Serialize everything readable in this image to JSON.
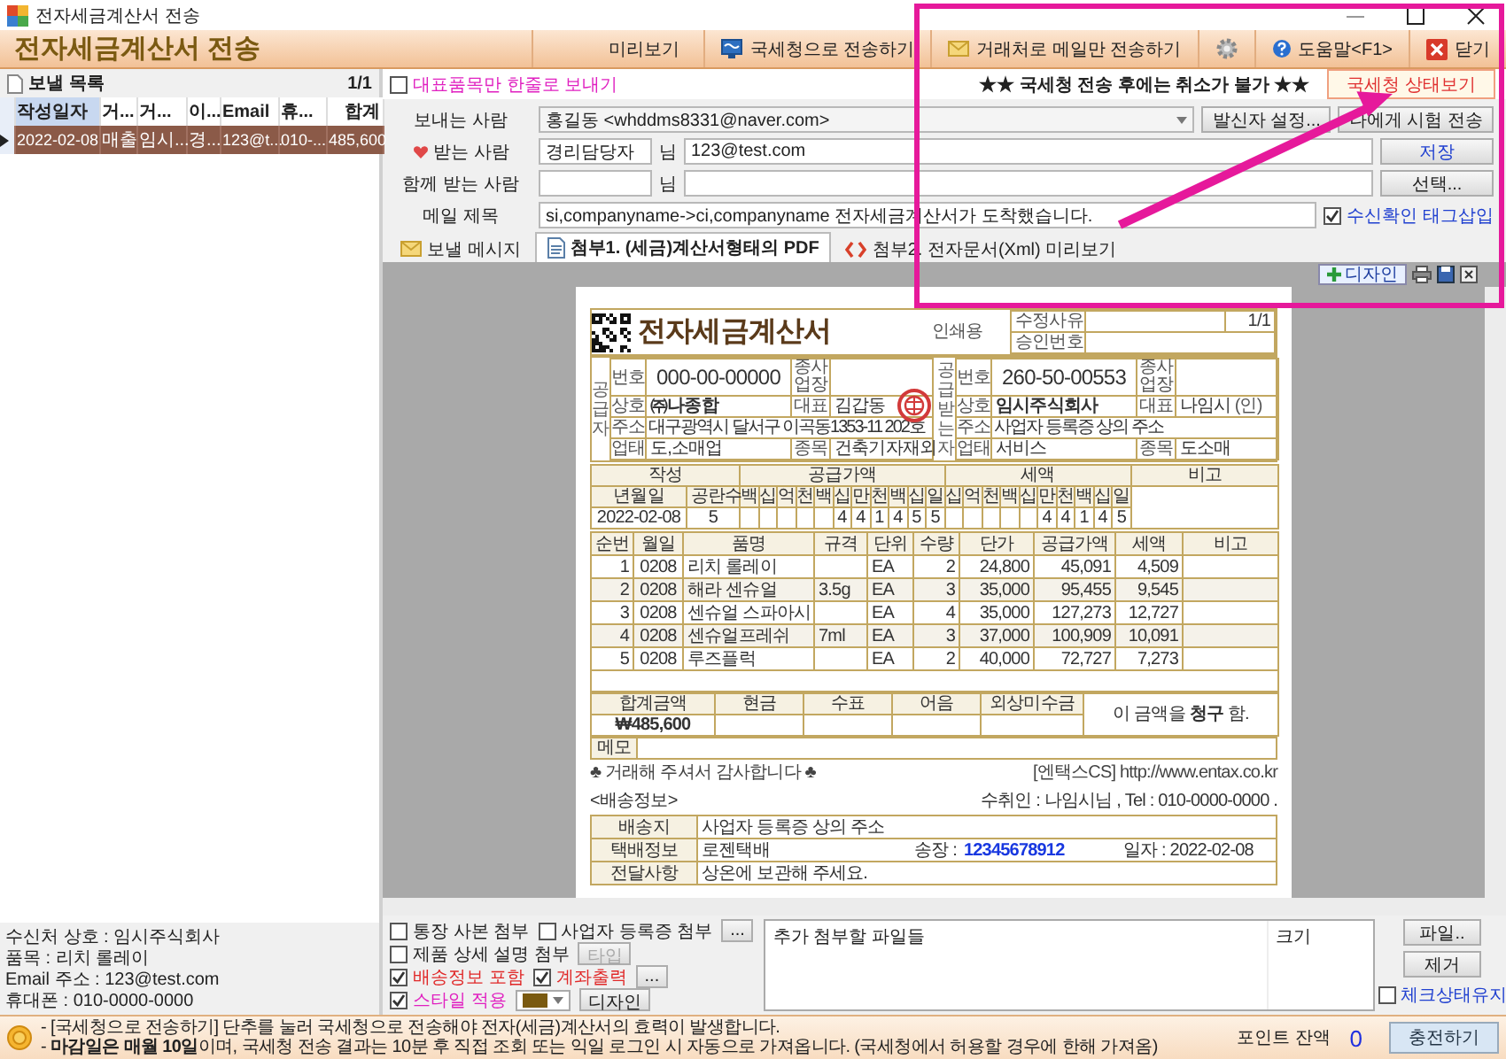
{
  "window": {
    "title": "전자세금계산서 전송"
  },
  "header": {
    "title": "전자세금계산서 전송"
  },
  "toolbar": [
    {
      "kind": "text",
      "label": "미리보기"
    },
    {
      "kind": "send",
      "label": "국세청으로 전송하기"
    },
    {
      "kind": "mail",
      "label": "거래처로 메일만 전송하기"
    },
    {
      "kind": "gear"
    },
    {
      "kind": "help",
      "label": "도움말<F1>"
    },
    {
      "kind": "close",
      "label": "닫기"
    }
  ],
  "send_list": {
    "title": "보낼 목록",
    "page": "1/1",
    "columns": [
      "작성일자",
      "거...",
      "거...",
      "이...",
      "Email",
      "휴...",
      "합계"
    ],
    "rows": [
      {
        "selected": true,
        "cells": [
          "2022-02-08",
          "매출",
          "임시...",
          "경...",
          "123@t...",
          "010-...",
          "485,600"
        ]
      }
    ]
  },
  "summary": [
    "수신처 상호 : 임시주식회사",
    "품목 : 리치 롤레이",
    "Email 주소 : 123@test.com",
    "휴대폰 : 010-0000-0000"
  ],
  "one_line_option": {
    "label": "대표품목만 한줄로 보내기",
    "checked": false
  },
  "warning": "★★ 국세청 전송 후에는 취소가 불가 ★★",
  "status_button": "국세청 상태보기",
  "sender": {
    "label": "보내는 사람",
    "value": "홍길동 <whddms8331@naver.com>",
    "buttons": [
      "발신자 설정...",
      "나에게 시험 전송"
    ]
  },
  "recipient": {
    "label": "받는 사람",
    "name": "경리담당자",
    "suffix": "님",
    "email": "123@test.com",
    "button": "저장"
  },
  "cc": {
    "label": "함께 받는 사람",
    "suffix": "님",
    "button": "선택..."
  },
  "subject": {
    "label": "메일 제목",
    "value": "si,companyname->ci,companyname 전자세금계산서가 도착했습니다.",
    "option": {
      "label": "수신확인 태그삽입",
      "checked": true
    }
  },
  "tabs": [
    {
      "kind": "mail",
      "label": "보낼 메시지",
      "selected": false
    },
    {
      "kind": "pdf",
      "label": "첨부1. (세금)계산서형태의 PDF",
      "selected": true
    },
    {
      "kind": "xml",
      "label": "첨부2. 전자문서(Xml) 미리보기",
      "selected": false
    }
  ],
  "preview": {
    "design_button": "디자인"
  },
  "invoice": {
    "title": "전자세금계산서",
    "copy_label": "인쇄용",
    "revision_label": "수정사유",
    "page": "1/1",
    "approval_label": "승인번호",
    "supplier": {
      "side_label": "공급자",
      "reg_label": "번호",
      "reg_no": "000-00-00000",
      "branch_label": "종사업장",
      "name_label": "상호",
      "name": "㈜나종합",
      "ceo_label": "대표",
      "ceo": "김갑동",
      "address_label": "주소",
      "address": "대구광역시 달서구 이곡동1353-11 202호",
      "type_label": "업태",
      "business_type": "도,소매업",
      "item_label": "종목",
      "business_item": "건축기자재외"
    },
    "buyer": {
      "side_label": "공급받는자",
      "reg_label": "번호",
      "reg_no": "260-50-00553",
      "branch_label": "종사업장",
      "name_label": "상호",
      "name": "임시주식회사",
      "ceo_label": "대표",
      "ceo": "나임시",
      "seal": "(인)",
      "address_label": "주소",
      "address": "사업자 등록증 상의 주소",
      "type_label": "업태",
      "business_type": "서비스",
      "item_label": "종목",
      "business_item": "도소매"
    },
    "amount": {
      "date_header": "작성",
      "supply_header": "공급가액",
      "tax_header": "세액",
      "note_header": "비고",
      "date_sub": "년월일",
      "blank_sub": "공란수",
      "supply_digit_labels": [
        "백",
        "십",
        "억",
        "천",
        "백",
        "십",
        "만",
        "천",
        "백",
        "십",
        "일"
      ],
      "tax_digit_labels": [
        "십",
        "억",
        "천",
        "백",
        "십",
        "만",
        "천",
        "백",
        "십",
        "일"
      ],
      "date": "2022-02-08",
      "blanks": "5",
      "supply_digits": [
        "4",
        "4",
        "1",
        "4",
        "5",
        "5"
      ],
      "tax_digits": [
        "4",
        "4",
        "1",
        "4",
        "5"
      ]
    },
    "item_columns": [
      "순번",
      "월일",
      "품명",
      "규격",
      "단위",
      "수량",
      "단가",
      "공급가액",
      "세액",
      "비고"
    ],
    "items": [
      {
        "no": "1",
        "date": "0208",
        "name": "리치 롤레이",
        "unit": "EA",
        "qty": "2",
        "price": "24,800",
        "supply": "45,091",
        "tax": "4,509"
      },
      {
        "no": "2",
        "date": "0208",
        "name": "해라 센슈얼",
        "spec": "3.5g",
        "unit": "EA",
        "qty": "3",
        "price": "35,000",
        "supply": "95,455",
        "tax": "9,545"
      },
      {
        "no": "3",
        "date": "0208",
        "name": "센슈얼 스파아시",
        "unit": "EA",
        "qty": "4",
        "price": "35,000",
        "supply": "127,273",
        "tax": "12,727"
      },
      {
        "no": "4",
        "date": "0208",
        "name": "센슈얼프레쉬",
        "spec": "7ml",
        "unit": "EA",
        "qty": "3",
        "price": "37,000",
        "supply": "100,909",
        "tax": "10,091"
      },
      {
        "no": "5",
        "date": "0208",
        "name": "루즈플럭",
        "unit": "EA",
        "qty": "2",
        "price": "40,000",
        "supply": "72,727",
        "tax": "7,273"
      }
    ],
    "total_labels": [
      "합계금액",
      "현금",
      "수표",
      "어음",
      "외상미수금"
    ],
    "total": "₩485,600",
    "claim": "이 금액을 **청구** 함.",
    "memo_label": "메모",
    "thanks": "♣ 거래해 주셔서 감사합니다 ♣",
    "site": "[엔택스CS] http://www.entax.co.kr",
    "shipping": {
      "title": "<배송정보>",
      "receiver": "수취인 : 나임시님 , Tel : 010-0000-0000 .",
      "address_label": "배송지",
      "address": "사업자 등록증 상의 주소",
      "courier_label": "택배정보",
      "courier": "로젠택배",
      "tracking_label": "송장 :",
      "tracking_no": "12345678912",
      "date": "일자 : 2022-02-08",
      "note_label": "전달사항",
      "note": "상온에 보관해 주세요."
    }
  },
  "option_rows": [
    {
      "items": [
        {
          "kind": "check",
          "label": "통장 사본 첨부",
          "checked": false,
          "color": "#222222"
        },
        {
          "kind": "check",
          "label": "사업자 등록증 첨부",
          "checked": false,
          "color": "#222222"
        },
        {
          "kind": "button",
          "label": "...",
          "disabled": false
        }
      ]
    },
    {
      "items": [
        {
          "kind": "check",
          "label": "제품 상세 설명 첨부",
          "checked": false,
          "color": "#222222"
        },
        {
          "kind": "button",
          "label": "타입",
          "disabled": true
        }
      ]
    },
    {
      "items": [
        {
          "kind": "check",
          "label": "배송정보 포함",
          "checked": true,
          "color": "#e02828"
        },
        {
          "kind": "check",
          "label": "계좌출력",
          "checked": true,
          "color": "#e02828"
        },
        {
          "kind": "button",
          "label": "...",
          "disabled": false
        }
      ]
    },
    {
      "items": [
        {
          "kind": "check",
          "label": "스타일 적용",
          "checked": true,
          "color": "#e020c0"
        },
        {
          "kind": "color",
          "color": "#7a5a10"
        },
        {
          "kind": "button",
          "label": "디자인",
          "disabled": false
        }
      ]
    }
  ],
  "attachments": {
    "columns": [
      "추가 첨부할 파일들",
      "크기"
    ],
    "buttons": [
      "파일..",
      "제거"
    ],
    "keep_check": {
      "label": "체크상태유지",
      "checked": false
    }
  },
  "notices": [
    "- [국세청으로 전송하기] 단추를 눌러 국세청으로 전송해야 전자(세금)계산서의 효력이 발생합니다.",
    "- **마감일은 매월 10일**이며, 국세청 전송 결과는 10분 후 직접 조회 또는 익일 로그인 시 자동으로 가져옵니다. (국세청에서 허용할 경우에 한해 가져옴)"
  ],
  "points": {
    "label": "포인트 잔액",
    "value": "0"
  },
  "charge_button": "충전하기"
}
